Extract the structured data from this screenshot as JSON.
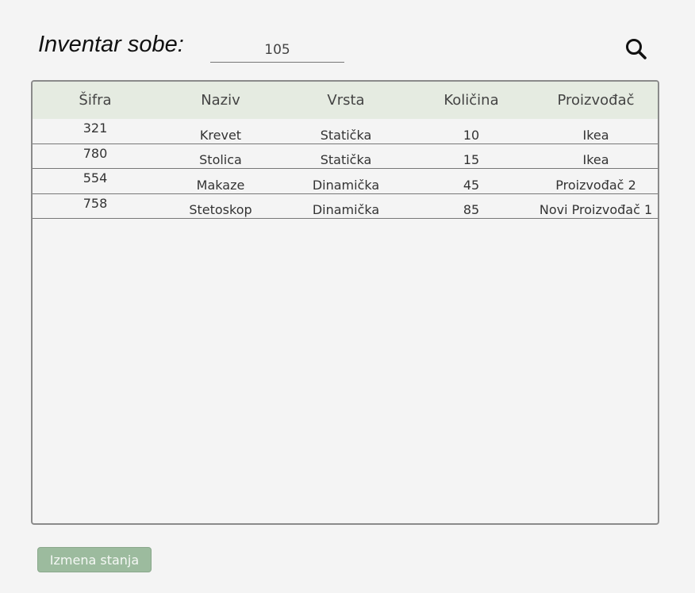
{
  "header": {
    "title": "Inventar sobe:",
    "room_number": "105",
    "search_icon": "search-icon"
  },
  "table": {
    "columns": [
      "Šifra",
      "Naziv",
      "Vrsta",
      "Količina",
      "Proizvođač"
    ],
    "rows": [
      [
        "321",
        "Krevet",
        "Statička",
        "10",
        "Ikea"
      ],
      [
        "780",
        "Stolica",
        "Statička",
        "15",
        "Ikea"
      ],
      [
        "554",
        "Makaze",
        "Dinamička",
        "45",
        "Proizvođač 2"
      ],
      [
        "758",
        "Stetoskop",
        "Dinamička",
        "85",
        "Novi Proizvođač 1"
      ]
    ]
  },
  "footer": {
    "action_label": "Izmena stanja"
  },
  "colors": {
    "header_bg": "#e5ebe1",
    "button_bg": "#9cbb9e",
    "page_bg": "#f4f4f4"
  }
}
